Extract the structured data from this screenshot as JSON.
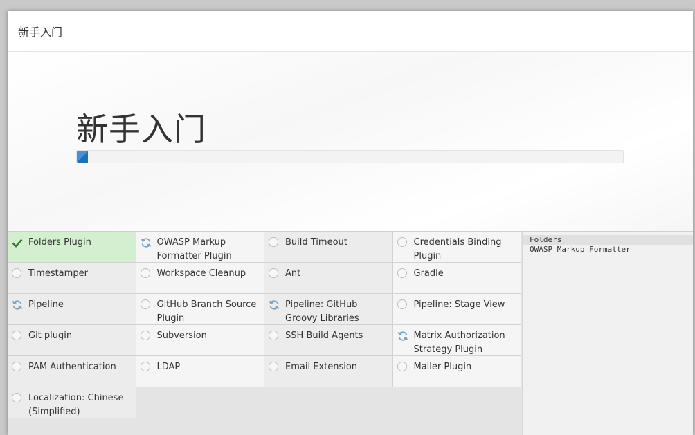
{
  "dialog": {
    "title": "新手入门"
  },
  "hero": {
    "title": "新手入门",
    "progress": 0.02
  },
  "plugins": [
    {
      "label": "Folders Plugin",
      "status": "installed",
      "icon": "check-icon"
    },
    {
      "label": "OWASP Markup Formatter Plugin",
      "status": "installing",
      "icon": "refresh-icon"
    },
    {
      "label": "Build Timeout",
      "status": "pending",
      "icon": "radio-icon"
    },
    {
      "label": "Credentials Binding Plugin",
      "status": "pending",
      "icon": "radio-icon"
    },
    {
      "label": "Timestamper",
      "status": "pending",
      "icon": "radio-icon"
    },
    {
      "label": "Workspace Cleanup",
      "status": "pending",
      "icon": "radio-icon"
    },
    {
      "label": "Ant",
      "status": "pending",
      "icon": "radio-icon"
    },
    {
      "label": "Gradle",
      "status": "pending",
      "icon": "radio-icon"
    },
    {
      "label": "Pipeline",
      "status": "installing",
      "icon": "refresh-icon"
    },
    {
      "label": "GitHub Branch Source Plugin",
      "status": "pending",
      "icon": "radio-icon"
    },
    {
      "label": "Pipeline: GitHub Groovy Libraries",
      "status": "installing",
      "icon": "refresh-icon"
    },
    {
      "label": "Pipeline: Stage View",
      "status": "pending",
      "icon": "radio-icon"
    },
    {
      "label": "Git plugin",
      "status": "pending",
      "icon": "radio-icon"
    },
    {
      "label": "Subversion",
      "status": "pending",
      "icon": "radio-icon"
    },
    {
      "label": "SSH Build Agents",
      "status": "pending",
      "icon": "radio-icon"
    },
    {
      "label": "Matrix Authorization Strategy Plugin",
      "status": "installing",
      "icon": "refresh-icon"
    },
    {
      "label": "PAM Authentication",
      "status": "pending",
      "icon": "radio-icon"
    },
    {
      "label": "LDAP",
      "status": "pending",
      "icon": "radio-icon"
    },
    {
      "label": "Email Extension",
      "status": "pending",
      "icon": "radio-icon"
    },
    {
      "label": "Mailer Plugin",
      "status": "pending",
      "icon": "radio-icon"
    },
    {
      "label": "Localization: Chinese (Simplified)",
      "status": "pending",
      "icon": "radio-icon"
    }
  ],
  "log": {
    "lines": [
      "Folders",
      "OWASP Markup Formatter"
    ]
  },
  "colors": {
    "installed": "#d4efd0",
    "check": "#2e7d32",
    "progress": "#3f95d6",
    "refresh": "#7aa3c4"
  }
}
